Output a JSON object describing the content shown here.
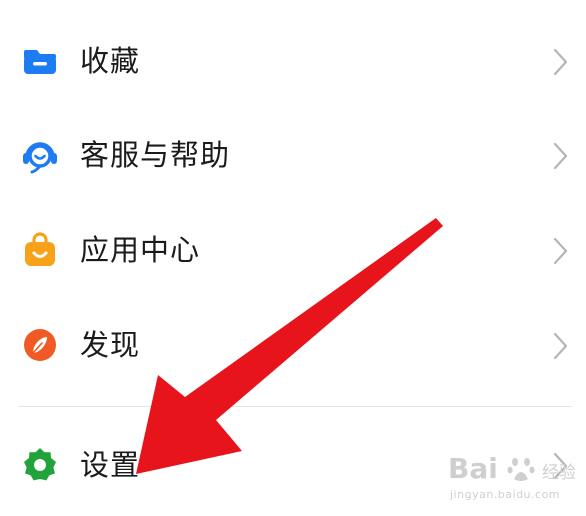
{
  "menu": {
    "items": [
      {
        "label": "收藏",
        "icon": "folder-icon",
        "color": "#1e7cf2"
      },
      {
        "label": "客服与帮助",
        "icon": "headset-icon",
        "color": "#1e7cf2"
      },
      {
        "label": "应用中心",
        "icon": "shopping-bag-icon",
        "color": "#f7a21b"
      },
      {
        "label": "发现",
        "icon": "compass-icon",
        "color": "#f05a24"
      },
      {
        "label": "设置",
        "icon": "gear-icon",
        "color": "#1fa33a"
      }
    ],
    "chevron_icon": "chevron-right-icon"
  },
  "annotation": {
    "icon": "red-arrow-icon",
    "color": "#e8141b"
  },
  "watermark": {
    "brand": "Bai 经验",
    "brand_main": "Bai",
    "brand_sub": "经验",
    "url": "jingyan.baidu.com"
  }
}
